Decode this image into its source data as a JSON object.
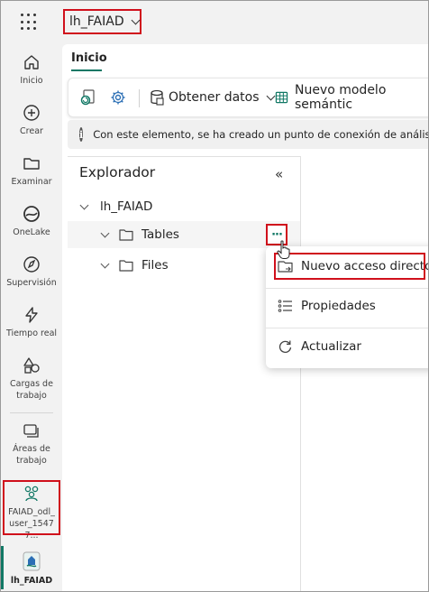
{
  "header": {
    "workspace_title": "lh_FAIAD"
  },
  "rail": {
    "items": [
      {
        "label": "Inicio",
        "icon": "home-icon"
      },
      {
        "label": "Crear",
        "icon": "plus-circle-icon"
      },
      {
        "label": "Examinar",
        "icon": "folder-icon"
      },
      {
        "label": "OneLake",
        "icon": "onelake-icon"
      },
      {
        "label": "Supervisión",
        "icon": "compass-icon"
      },
      {
        "label": "Tiempo real",
        "icon": "lightning-icon"
      },
      {
        "label": "Cargas de trabajo",
        "icon": "shapes-icon"
      },
      {
        "label": "Áreas de trabajo",
        "icon": "workspaces-icon"
      },
      {
        "label": "FAIAD_odl_user_15477...",
        "icon": "workspace-group-icon"
      },
      {
        "label": "lh_FAIAD",
        "icon": "lakehouse-icon"
      }
    ],
    "accent_color": "#117865"
  },
  "ribbon": {
    "active_tab": "Inicio",
    "get_data_label": "Obtener datos",
    "new_semantic_model_label": "Nuevo modelo semántic"
  },
  "info_bar": {
    "text": "Con este elemento, se ha creado un punto de conexión de análisis d"
  },
  "explorer": {
    "title": "Explorador",
    "root": "lh_FAIAD",
    "nodes": [
      "Tables",
      "Files"
    ],
    "more_label": "···"
  },
  "context_menu": {
    "items": [
      {
        "label": "Nuevo acceso directo",
        "icon": "shortcut-folder-icon"
      },
      {
        "label": "Propiedades",
        "icon": "properties-list-icon"
      },
      {
        "label": "Actualizar",
        "icon": "refresh-icon"
      }
    ]
  },
  "highlight_color": "#d0101c"
}
